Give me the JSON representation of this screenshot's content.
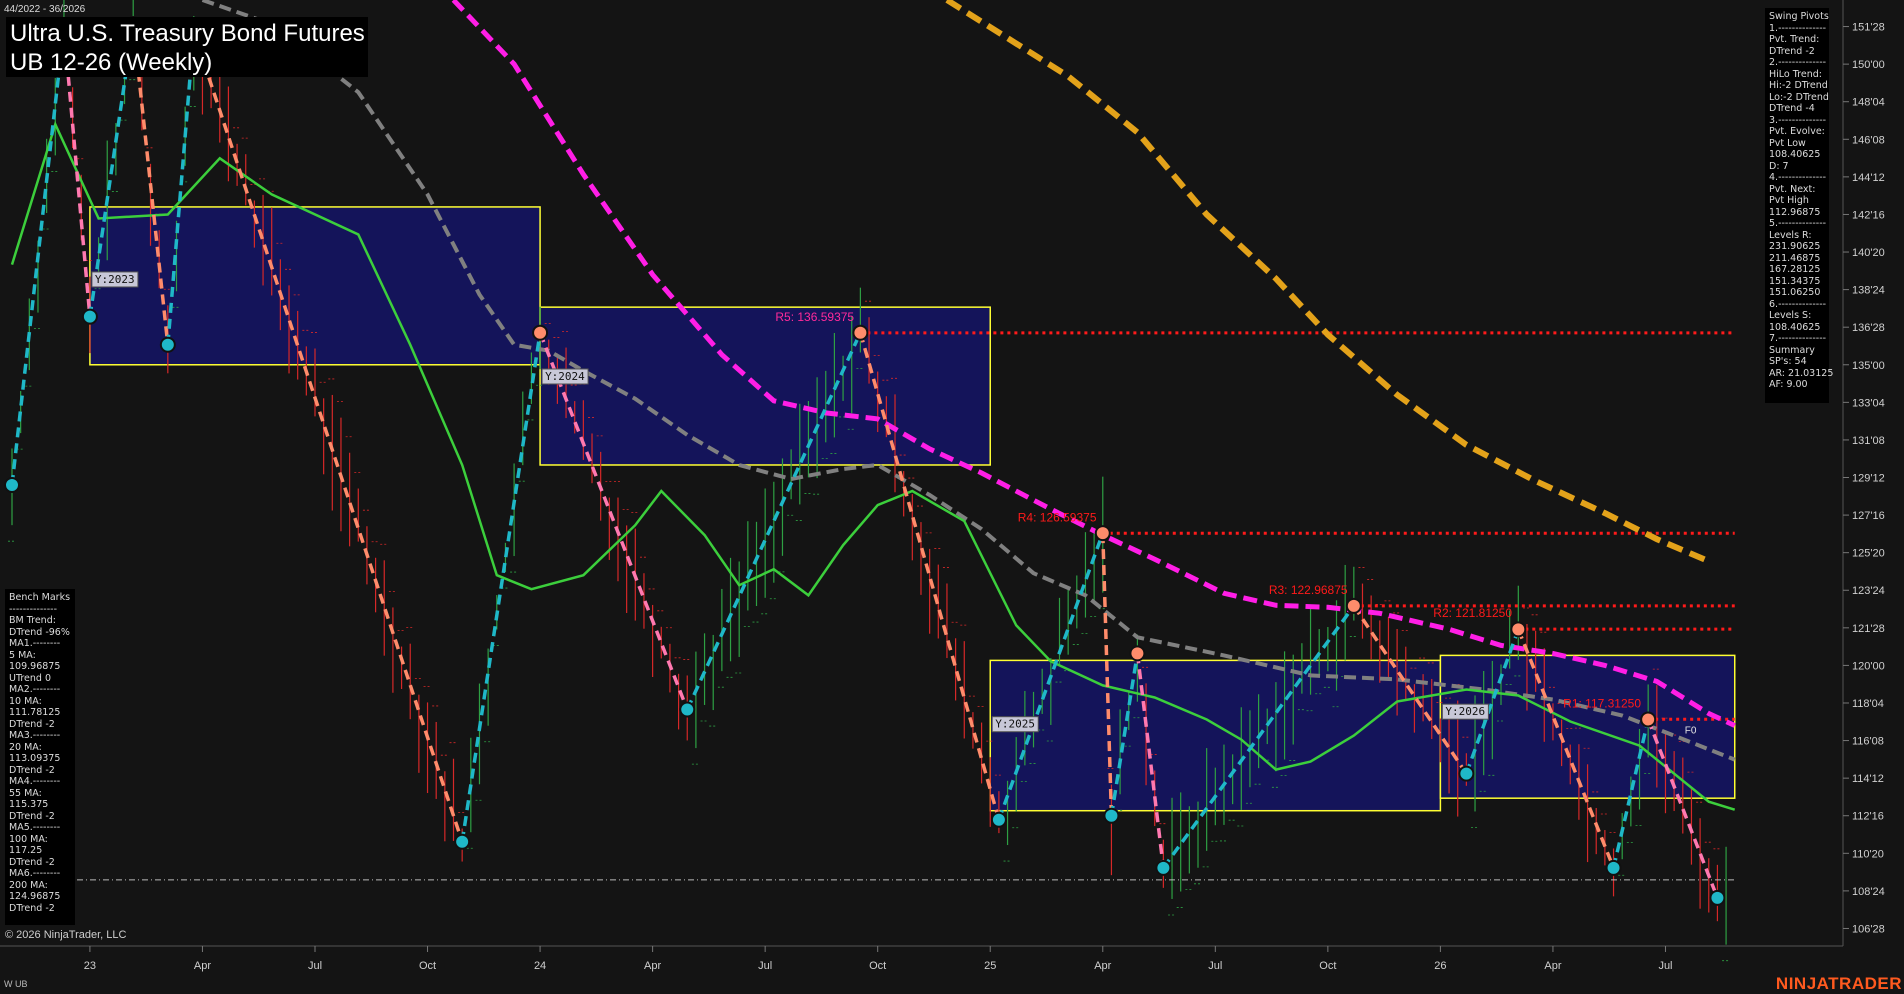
{
  "header": {
    "date_range": "44/2022 - 36/2026",
    "title": "Ultra U.S. Treasury Bond Futures",
    "subtitle": "UB 12-26 (Weekly)"
  },
  "swing_panel": {
    "lines": [
      "Swing Pivots",
      "1.--------------",
      "Pvt. Trend:",
      "DTrend -2",
      "2.--------------",
      "HiLo Trend:",
      "Hi:-2 DTrend",
      "Lo:-2 DTrend",
      "DTrend -4",
      "3.--------------",
      "Pvt. Evolve:",
      "Pvt Low",
      "108.40625",
      "D: 7",
      "4.--------------",
      "Pvt. Next:",
      "Pvt High",
      "112.96875",
      "5.--------------",
      "Levels R:",
      "231.90625",
      "211.46875",
      "167.28125",
      "151.34375",
      "151.06250",
      "6.--------------",
      "Levels S:",
      "108.40625",
      "7.--------------",
      "Summary",
      "SP's: 54",
      "AR: 21.03125",
      "AF: 9.00"
    ]
  },
  "bench_panel": {
    "lines": [
      "Bench Marks",
      "--------------",
      "BM Trend:",
      "DTrend -96%",
      "MA1.--------",
      "5 MA:",
      "109.96875",
      "UTrend 0",
      "MA2.--------",
      "10 MA:",
      "111.78125",
      "DTrend -2",
      "MA3.--------",
      "20 MA:",
      "113.09375",
      "DTrend -2",
      "MA4.--------",
      "55 MA:",
      "115.375",
      "DTrend -2",
      "MA5.--------",
      "100 MA:",
      "117.25",
      "DTrend -2",
      "MA6.--------",
      "200 MA:",
      "124.96875",
      "DTrend -2"
    ]
  },
  "footer": {
    "copyright": "© 2026 NinjaTrader, LLC",
    "instrument": "W UB",
    "brand": "NINJATRADER"
  },
  "colors": {
    "background": "#141414",
    "up_bar": "#2ea043",
    "down_bar": "#d62828",
    "ma_green": "#3ccf3c",
    "ma_grey": "#808080",
    "ma_magenta": "#ff1ee6",
    "ma_orange": "#e3a21a",
    "year_box_fill": "#14145a",
    "year_box_stroke": "#ffff33",
    "level_red": "#ff1a1a",
    "swing_up": "#1fb8c8",
    "swing_down": "#ff8c6b",
    "swing_down_pink": "#ff79b0"
  },
  "chart_data": {
    "type": "candlestick",
    "y_ticks": [
      "151'28",
      "150'00",
      "148'04",
      "146'08",
      "144'12",
      "142'16",
      "140'20",
      "138'24",
      "136'28",
      "135'00",
      "133'04",
      "131'08",
      "129'12",
      "127'16",
      "125'20",
      "123'24",
      "121'28",
      "120'00",
      "118'04",
      "116'08",
      "114'12",
      "112'16",
      "110'20",
      "108'24",
      "106'28"
    ],
    "y_tick_values": [
      151.875,
      150.0,
      148.125,
      146.25,
      144.375,
      142.5,
      140.625,
      138.75,
      136.875,
      135.0,
      133.125,
      131.25,
      129.375,
      127.5,
      125.625,
      123.75,
      121.875,
      120.0,
      118.125,
      116.25,
      114.375,
      112.5,
      110.625,
      108.75,
      106.875
    ],
    "ylim": [
      106.0,
      153.2
    ],
    "x_ticks": [
      "23",
      "Apr",
      "Jul",
      "Oct",
      "24",
      "Apr",
      "Jul",
      "Oct",
      "25",
      "Apr",
      "Jul",
      "Oct",
      "26",
      "Apr",
      "Jul"
    ],
    "x_tick_weeks": [
      9,
      22,
      35,
      48,
      61,
      74,
      87,
      100,
      113,
      126,
      139,
      152,
      165,
      178,
      191
    ],
    "year_boxes": [
      {
        "label": "Y:2023",
        "week_start": 9,
        "week_end": 61,
        "high": 142.875,
        "low": 135.0
      },
      {
        "label": "Y:2024",
        "week_start": 61,
        "week_end": 113,
        "high": 137.875,
        "low": 130.0
      },
      {
        "label": "Y:2025",
        "week_start": 113,
        "week_end": 165,
        "high": 120.25,
        "low": 112.75
      },
      {
        "label": "Y:2026",
        "week_start": 165,
        "week_end": 199,
        "high": 120.5,
        "low": 113.375
      }
    ],
    "resistance_levels": [
      {
        "label": "R5: 136.59375",
        "value": 136.59375,
        "week_start": 98
      },
      {
        "label": "R4: 126.59375",
        "value": 126.59375,
        "week_start": 126
      },
      {
        "label": "R3: 122.96875",
        "value": 122.96875,
        "week_start": 155
      },
      {
        "label": "R2: 121.81250",
        "value": 121.8125,
        "week_start": 174
      },
      {
        "label": "R1: 117.31250",
        "value": 117.3125,
        "week_start": 189
      }
    ],
    "dashdot_level": 109.3,
    "f0_label": "F0",
    "swings": [
      {
        "w": 0,
        "v": 129.0,
        "t": "L"
      },
      {
        "w": 6,
        "v": 151.8,
        "t": "H"
      },
      {
        "w": 9,
        "v": 137.4,
        "t": "L"
      },
      {
        "w": 14,
        "v": 152.0,
        "t": "H"
      },
      {
        "w": 18,
        "v": 136.0,
        "t": "L"
      },
      {
        "w": 21,
        "v": 151.6,
        "t": "H"
      },
      {
        "w": 52,
        "v": 111.2,
        "t": "L"
      },
      {
        "w": 61,
        "v": 136.6,
        "t": "H"
      },
      {
        "w": 78,
        "v": 117.8,
        "t": "L"
      },
      {
        "w": 98,
        "v": 136.6,
        "t": "H"
      },
      {
        "w": 114,
        "v": 112.3,
        "t": "L"
      },
      {
        "w": 126,
        "v": 126.6,
        "t": "H"
      },
      {
        "w": 127,
        "v": 112.5,
        "t": "L"
      },
      {
        "w": 130,
        "v": 120.6,
        "t": "H"
      },
      {
        "w": 133,
        "v": 109.9,
        "t": "L"
      },
      {
        "w": 155,
        "v": 122.97,
        "t": "H"
      },
      {
        "w": 168,
        "v": 114.6,
        "t": "L"
      },
      {
        "w": 174,
        "v": 121.8,
        "t": "H"
      },
      {
        "w": 185,
        "v": 109.9,
        "t": "L"
      },
      {
        "w": 189,
        "v": 117.3,
        "t": "H"
      },
      {
        "w": 197,
        "v": 108.4,
        "t": "L"
      }
    ],
    "ma_green": [
      [
        0,
        140
      ],
      [
        5,
        147
      ],
      [
        10,
        142.3
      ],
      [
        18,
        142.5
      ],
      [
        24,
        145.3
      ],
      [
        30,
        143.5
      ],
      [
        40,
        141.5
      ],
      [
        46,
        136
      ],
      [
        52,
        130
      ],
      [
        56,
        124.5
      ],
      [
        60,
        123.8
      ],
      [
        66,
        124.5
      ],
      [
        72,
        127
      ],
      [
        75,
        128.7
      ],
      [
        80,
        126.5
      ],
      [
        84,
        124
      ],
      [
        88,
        124.8
      ],
      [
        92,
        123.5
      ],
      [
        96,
        126
      ],
      [
        100,
        128
      ],
      [
        104,
        128.7
      ],
      [
        110,
        127.2
      ],
      [
        116,
        122
      ],
      [
        120,
        120.2
      ],
      [
        126,
        119
      ],
      [
        132,
        118.4
      ],
      [
        138,
        117.3
      ],
      [
        142,
        116.3
      ],
      [
        146,
        114.8
      ],
      [
        150,
        115.2
      ],
      [
        155,
        116.5
      ],
      [
        160,
        118.2
      ],
      [
        168,
        118.8
      ],
      [
        174,
        118.5
      ],
      [
        180,
        117.2
      ],
      [
        188,
        116
      ],
      [
        196,
        113.2
      ],
      [
        199,
        112.8
      ]
    ],
    "ma_grey": [
      [
        22,
        153.2
      ],
      [
        30,
        152
      ],
      [
        40,
        148.6
      ],
      [
        48,
        143.5
      ],
      [
        54,
        138.5
      ],
      [
        58,
        136
      ],
      [
        62,
        135.7
      ],
      [
        66,
        134.7
      ],
      [
        72,
        133.3
      ],
      [
        78,
        131.5
      ],
      [
        84,
        130
      ],
      [
        90,
        129.3
      ],
      [
        96,
        129.8
      ],
      [
        100,
        130
      ],
      [
        106,
        128.5
      ],
      [
        112,
        126.8
      ],
      [
        118,
        124.6
      ],
      [
        124,
        123.5
      ],
      [
        130,
        121.4
      ],
      [
        140,
        120.5
      ],
      [
        150,
        119.5
      ],
      [
        160,
        119.3
      ],
      [
        170,
        118.8
      ],
      [
        178,
        118.3
      ],
      [
        186,
        117.5
      ],
      [
        192,
        116.5
      ],
      [
        199,
        115.3
      ]
    ],
    "ma_magenta": [
      [
        51,
        153.2
      ],
      [
        58,
        150
      ],
      [
        66,
        144.5
      ],
      [
        74,
        139.5
      ],
      [
        82,
        135.5
      ],
      [
        88,
        133.2
      ],
      [
        94,
        132.6
      ],
      [
        100,
        132.3
      ],
      [
        106,
        130.8
      ],
      [
        112,
        129.6
      ],
      [
        120,
        127.8
      ],
      [
        126,
        126.5
      ],
      [
        132,
        125.3
      ],
      [
        140,
        123.6
      ],
      [
        146,
        123
      ],
      [
        152,
        122.9
      ],
      [
        158,
        122.6
      ],
      [
        166,
        121.8
      ],
      [
        172,
        121
      ],
      [
        178,
        120.6
      ],
      [
        184,
        120
      ],
      [
        190,
        119.2
      ],
      [
        196,
        117.6
      ],
      [
        199,
        117
      ]
    ],
    "ma_orange": [
      [
        108,
        153.2
      ],
      [
        115,
        151.3
      ],
      [
        122,
        149.4
      ],
      [
        130,
        146.6
      ],
      [
        138,
        142.5
      ],
      [
        146,
        139.3
      ],
      [
        152,
        136.5
      ],
      [
        160,
        133.5
      ],
      [
        168,
        131
      ],
      [
        176,
        129.2
      ],
      [
        184,
        127.6
      ],
      [
        190,
        126.3
      ],
      [
        196,
        125.2
      ]
    ]
  }
}
